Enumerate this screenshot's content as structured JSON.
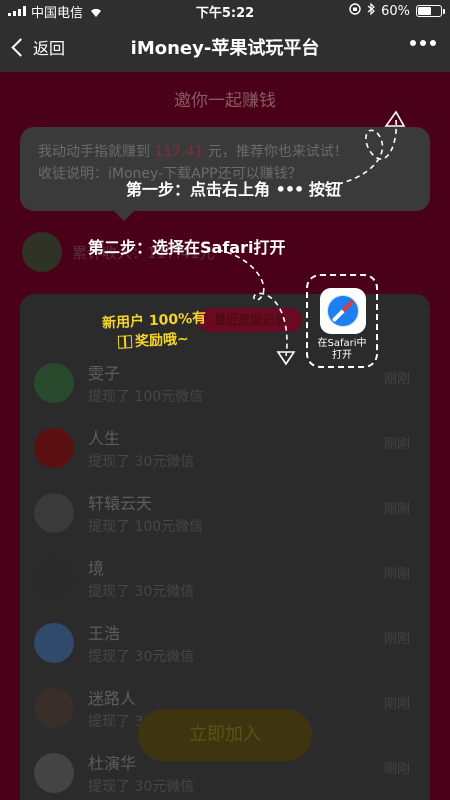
{
  "status_bar": {
    "carrier": "中国电信",
    "time": "下午5:22",
    "battery_percent": "60%",
    "battery_level": 0.6
  },
  "nav": {
    "back_label": "返回",
    "title": "iMoney-苹果试玩平台"
  },
  "content": {
    "invite_title": "邀你一起赚钱",
    "bubble_line1_prefix": "我动动手指就赚到 ",
    "bubble_amount": "117.41",
    "bubble_line1_suffix": " 元，推荐你也来试试！",
    "bubble_line2": "收徒说明：iMoney-下载APP还可以赚钱？",
    "inviter_text": "累计收入：117.41元",
    "red_button": "最近提现记录",
    "join_button": "立即加入",
    "withdrawals": [
      {
        "name": "雯子",
        "detail": "提现了 100元微信",
        "time": "刚刚"
      },
      {
        "name": "人生",
        "detail": "提现了 30元微信",
        "time": "刚刚"
      },
      {
        "name": "轩辕云天",
        "detail": "提现了 100元微信",
        "time": "刚刚"
      },
      {
        "name": "境",
        "detail": "提现了 30元微信",
        "time": "刚刚"
      },
      {
        "name": "王浩",
        "detail": "提现了 30元微信",
        "time": "刚刚"
      },
      {
        "name": "迷路人",
        "detail": "提现了 30元微信",
        "time": "刚刚"
      },
      {
        "name": "杜演华",
        "detail": "提现了 30元微信",
        "time": "刚刚"
      }
    ]
  },
  "guide": {
    "step1": "第一步：点击右上角",
    "step1_tail": "按钮",
    "step2": "第二步：选择在Safari打开",
    "promo_line1": "新用户 100%有",
    "promo_line2": "奖励哦~",
    "safari_label_line1": "在Safari中",
    "safari_label_line2": "打开"
  },
  "colors": {
    "nav_bg": "#2f2f2f",
    "page_bg": "#4a0018",
    "promo_yellow": "#f4d52a",
    "safari_blue": "#1e7ff0"
  }
}
